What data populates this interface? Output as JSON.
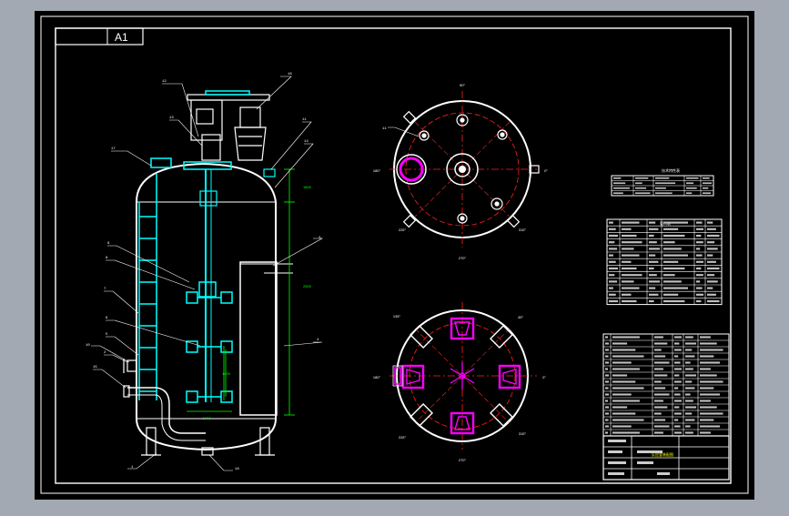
{
  "sheet": {
    "size_label": "A1",
    "colors": {
      "window_bg": "#a3a9b2",
      "sheet_bg": "#000000",
      "frame": "#ffffff",
      "vessel": "#ffffff",
      "agitator": "#00ffff",
      "flange": "#00ffff",
      "leader": "#ffffff",
      "dim": "#00ff00",
      "centerline": "#ff2020",
      "nozzle_highlight": "#ff00ff",
      "table_text": "#ffffff"
    }
  },
  "front_view": {
    "balloons": [
      "12",
      "13",
      "16",
      "17",
      "11",
      "14",
      "9",
      "8",
      "7",
      "6",
      "5",
      "2",
      "3",
      "10",
      "15",
      "4",
      "1",
      "18"
    ],
    "dimensions": [
      "1000",
      "2500",
      "1400",
      "1800"
    ]
  },
  "top_view": {
    "angles": [
      "90°",
      "180°",
      "0°",
      "270°",
      "315°",
      "225°"
    ],
    "balloons": [
      "11"
    ]
  },
  "bottom_view": {
    "angles": [
      "180°",
      "45°",
      "135°",
      "0°",
      "225°",
      "270°",
      "315°"
    ]
  },
  "tech_table": {
    "title": "技术特性表",
    "rows": 4
  },
  "nozzle_table": {
    "title": "管口表",
    "rows": 13
  },
  "parts_list": {
    "rows": 16
  },
  "title_block": {
    "drawing_title": "反应釜装配图"
  }
}
